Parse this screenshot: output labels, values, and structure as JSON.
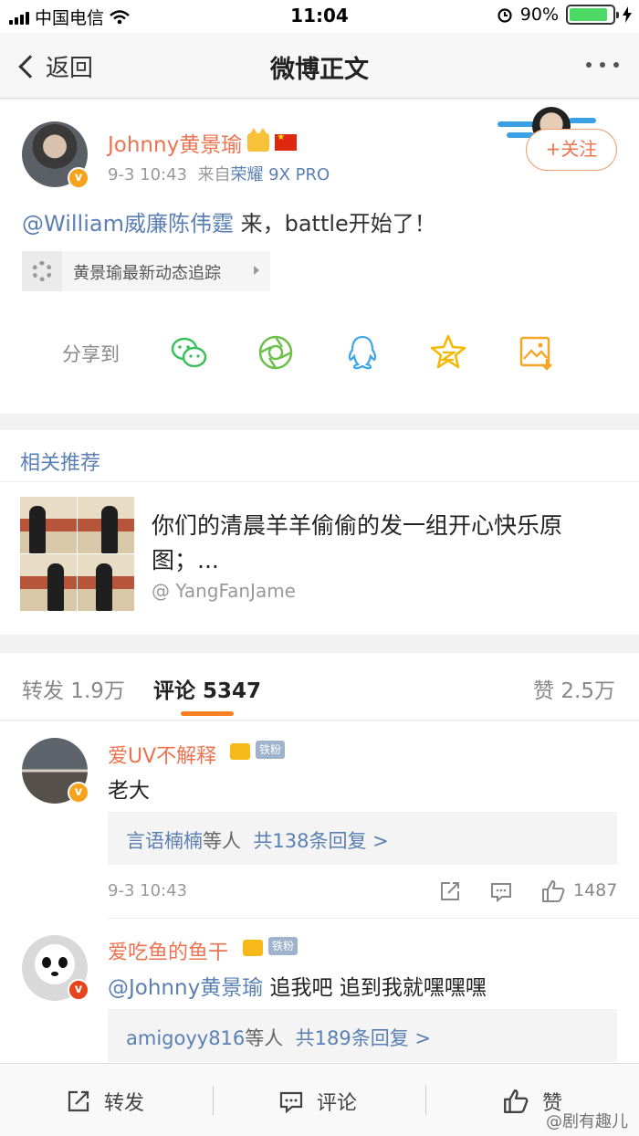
{
  "status_bar": {
    "carrier": "中国电信",
    "time": "11:04",
    "battery_pct": "90%",
    "battery_level": 0.9
  },
  "nav": {
    "back_label": "返回",
    "title": "微博正文"
  },
  "post": {
    "author_name": "Johnny黄景瑜",
    "time": "9-3 10:43",
    "source_prefix": "来自",
    "source_device": "荣耀 9X PRO",
    "follow_label": "+关注",
    "mention": "@William威廉陈伟霆",
    "text": " 来，battle开始了！",
    "topic_label": "黄景瑜最新动态追踪",
    "share_label": "分享到",
    "share_icons": [
      "wechat-icon",
      "moments-icon",
      "qq-icon",
      "qzone-icon",
      "save-image-icon"
    ]
  },
  "related": {
    "title": "相关推荐",
    "text": "你们的清晨羊羊偷偷的发一组开心快乐原图；...",
    "author": "@ YangFanJame"
  },
  "tabs": {
    "repost": "转发 1.9万",
    "comment": "评论 5347",
    "like": "赞 2.5万"
  },
  "comments": [
    {
      "name": "爱UV不解释",
      "badge": "铁粉",
      "text": "老大",
      "reply_users": "言语楠楠",
      "reply_mid": "等人",
      "reply_count": "共138条回复 >",
      "time": "9-3 10:43",
      "likes": "1487"
    },
    {
      "name": "爱吃鱼的鱼干",
      "badge": "铁粉",
      "mention": "@Johnny黄景瑜",
      "text": " 追我吧 追到我就嘿嘿嘿",
      "reply_users": "amigoyy816",
      "reply_mid": "等人",
      "reply_count": "共189条回复 >"
    }
  ],
  "toolbar": {
    "repost": "转发",
    "comment": "评论",
    "like": "赞"
  },
  "watermark": "@剧有趣儿",
  "colors": {
    "orange_name": "#eb7350",
    "link_blue": "#5a7fb3",
    "tab_accent": "#fb7e23"
  }
}
